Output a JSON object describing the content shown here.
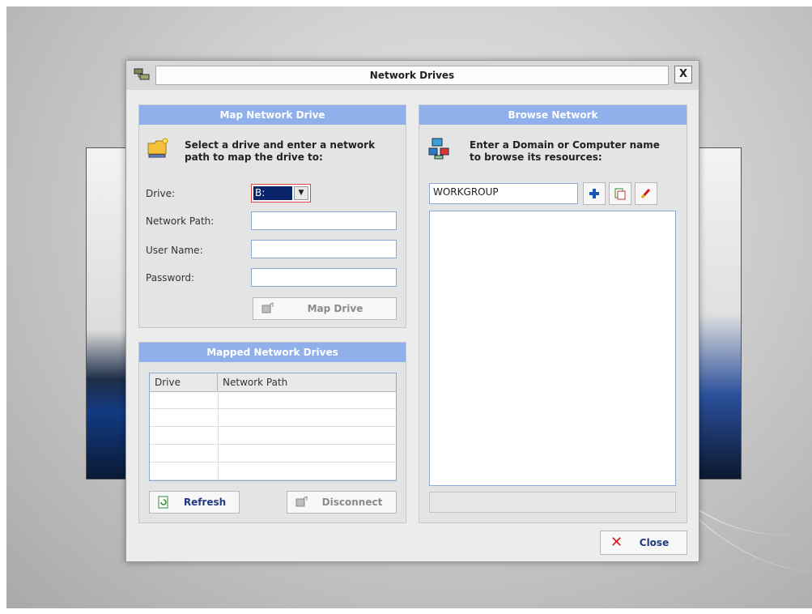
{
  "window": {
    "title": "Network Drives",
    "close_glyph": "X"
  },
  "map_panel": {
    "header": "Map Network Drive",
    "instruction_line1": "Select a drive and enter a network",
    "instruction_line2": "path to map the drive to:",
    "icon": "folder-network-icon",
    "drive_label": "Drive:",
    "drive_value": "B:",
    "network_path_label": "Network Path:",
    "network_path_value": "",
    "user_name_label": "User Name:",
    "user_name_value": "",
    "password_label": "Password:",
    "password_value": "",
    "map_button": "Map Drive"
  },
  "mapped_panel": {
    "header": "Mapped Network Drives",
    "columns": [
      "Drive",
      "Network Path"
    ],
    "rows": [],
    "refresh_button": "Refresh",
    "disconnect_button": "Disconnect"
  },
  "browse_panel": {
    "header": "Browse Network",
    "instruction_line1": "Enter a Domain or Computer name",
    "instruction_line2": "to browse its resources:",
    "domain_value": "WORKGROUP",
    "toolbar_icons": [
      "add-icon",
      "copy-icon",
      "clear-icon"
    ]
  },
  "footer": {
    "close_button": "Close"
  },
  "colors": {
    "panel_header": "#8fb0ea",
    "accent_red": "#d21b1b",
    "link_blue": "#203a80"
  }
}
